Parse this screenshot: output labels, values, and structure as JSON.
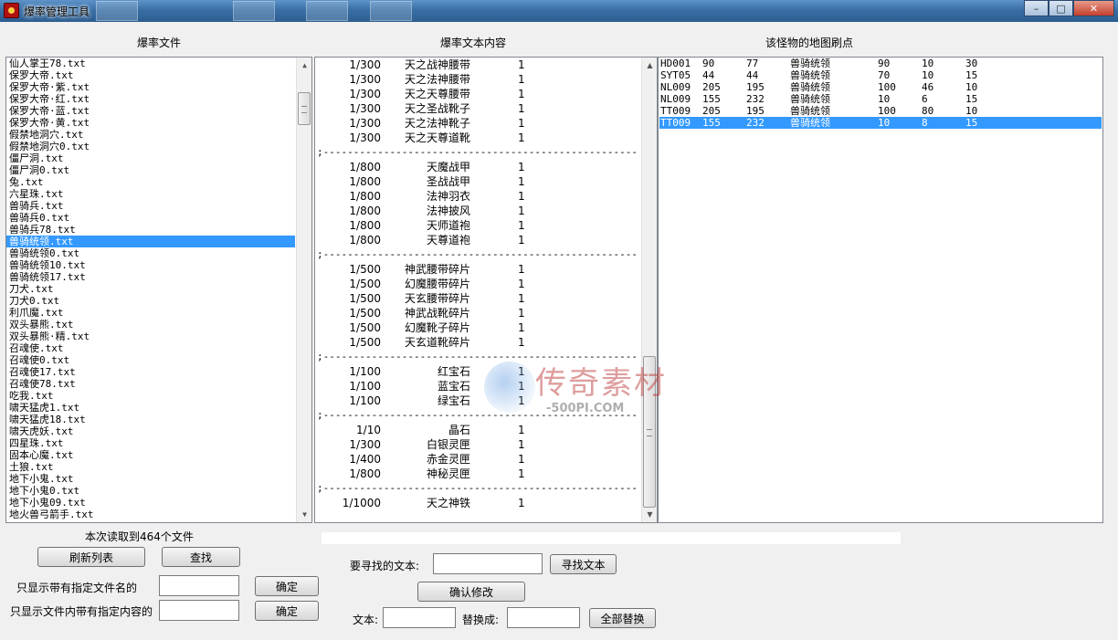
{
  "window": {
    "title": "爆率管理工具",
    "controls": {
      "minimize": "–",
      "maximize": "□",
      "close": "✕"
    }
  },
  "headers": {
    "files": "爆率文件",
    "content": "爆率文本内容",
    "spawns": "该怪物的地图刷点"
  },
  "files": {
    "items": [
      "仙人掌王78.txt",
      "保罗大帝.txt",
      "保罗大帝·紫.txt",
      "保罗大帝·红.txt",
      "保罗大帝·蓝.txt",
      "保罗大帝·黄.txt",
      "假禁地洞穴.txt",
      "假禁地洞穴0.txt",
      "僵尸洞.txt",
      "僵尸洞0.txt",
      "兔.txt",
      "六星珠.txt",
      "兽骑兵.txt",
      "兽骑兵0.txt",
      "兽骑兵78.txt",
      "兽骑统领.txt",
      "兽骑统领0.txt",
      "兽骑统领10.txt",
      "兽骑统领17.txt",
      "刀犬.txt",
      "刀犬0.txt",
      "利爪魔.txt",
      "双头暴熊.txt",
      "双头暴熊·精.txt",
      "召魂使.txt",
      "召魂使0.txt",
      "召魂使17.txt",
      "召魂使78.txt",
      "吃我.txt",
      "啸天猛虎1.txt",
      "啸天猛虎18.txt",
      "啸天虎妖.txt",
      "四星珠.txt",
      "固本心魔.txt",
      "土狼.txt",
      "地下小鬼.txt",
      "地下小鬼0.txt",
      "地下小鬼09.txt",
      "地火兽弓箭手.txt"
    ],
    "selected_index": 15,
    "count_text": "本次读取到464个文件"
  },
  "content": {
    "groups": [
      {
        "rows": [
          [
            "1/300",
            "天之战神腰带",
            "1"
          ],
          [
            "1/300",
            "天之法神腰带",
            "1"
          ],
          [
            "1/300",
            "天之天尊腰带",
            "1"
          ],
          [
            "1/300",
            "天之圣战靴子",
            "1"
          ],
          [
            "1/300",
            "天之法神靴子",
            "1"
          ],
          [
            "1/300",
            "天之天尊道靴",
            "1"
          ]
        ],
        "separator": ";------------------------------------------------------"
      },
      {
        "rows": [
          [
            "1/800",
            "天魔战甲",
            "1"
          ],
          [
            "1/800",
            "圣战战甲",
            "1"
          ],
          [
            "1/800",
            "法神羽衣",
            "1"
          ],
          [
            "1/800",
            "法神披风",
            "1"
          ],
          [
            "1/800",
            "天师道袍",
            "1"
          ],
          [
            "1/800",
            "天尊道袍",
            "1"
          ]
        ],
        "separator": ";------------------------------------------------------------"
      },
      {
        "rows": [
          [
            "1/500",
            "神武腰带碎片",
            "1"
          ],
          [
            "1/500",
            "幻魔腰带碎片",
            "1"
          ],
          [
            "1/500",
            "天玄腰带碎片",
            "1"
          ],
          [
            "1/500",
            "神武战靴碎片",
            "1"
          ],
          [
            "1/500",
            "幻魔靴子碎片",
            "1"
          ],
          [
            "1/500",
            "天玄道靴碎片",
            "1"
          ]
        ],
        "separator": ";------------------------------------------------------"
      },
      {
        "rows": [
          [
            "1/100",
            "红宝石",
            "1"
          ],
          [
            "1/100",
            "蓝宝石",
            "1"
          ],
          [
            "1/100",
            "绿宝石",
            "1"
          ]
        ],
        "separator": ";------------------------------------------------------"
      },
      {
        "rows": [
          [
            "1/10",
            "晶石",
            "1"
          ],
          [
            "1/300",
            "白银灵匣",
            "1"
          ],
          [
            "1/400",
            "赤金灵匣",
            "1"
          ],
          [
            "1/800",
            "神秘灵匣",
            "1"
          ]
        ],
        "separator": ";------------------------------------------------------"
      },
      {
        "rows": [
          [
            "1/1000",
            "天之神铁",
            "1"
          ]
        ],
        "separator": ""
      }
    ]
  },
  "spawns": {
    "rows": [
      [
        "HD001",
        "90",
        "77",
        "兽骑统领",
        "90",
        "10",
        "30"
      ],
      [
        "SYT05",
        "44",
        "44",
        "兽骑统领",
        "70",
        "10",
        "15"
      ],
      [
        "NL009",
        "205",
        "195",
        "兽骑统领",
        "100",
        "46",
        "10"
      ],
      [
        "NL009",
        "155",
        "232",
        "兽骑统领",
        "10",
        "6",
        "15"
      ],
      [
        "TT009",
        "205",
        "195",
        "兽骑统领",
        "100",
        "80",
        "10"
      ],
      [
        "TT009",
        "155",
        "232",
        "兽骑统领",
        "10",
        "8",
        "15"
      ]
    ],
    "selected_index": 5
  },
  "watermark": {
    "text": "传奇素材",
    "sub": "-500PI.COM"
  },
  "controls": {
    "refresh_label": "刷新列表",
    "find_label": "查找",
    "filter_name_label": "只显示带有指定文件名的",
    "filter_name_value": "",
    "filter_name_confirm": "确定",
    "filter_content_label": "只显示文件内带有指定内容的",
    "filter_content_value": "",
    "filter_content_confirm": "确定",
    "search_text_label": "要寻找的文本:",
    "search_text_value": "",
    "search_button": "寻找文本",
    "confirm_edit_button": "确认修改",
    "replace_from_label": "文本:",
    "replace_from_value": "",
    "replace_to_label": "替换成:",
    "replace_to_value": "",
    "replace_all_button": "全部替换"
  }
}
